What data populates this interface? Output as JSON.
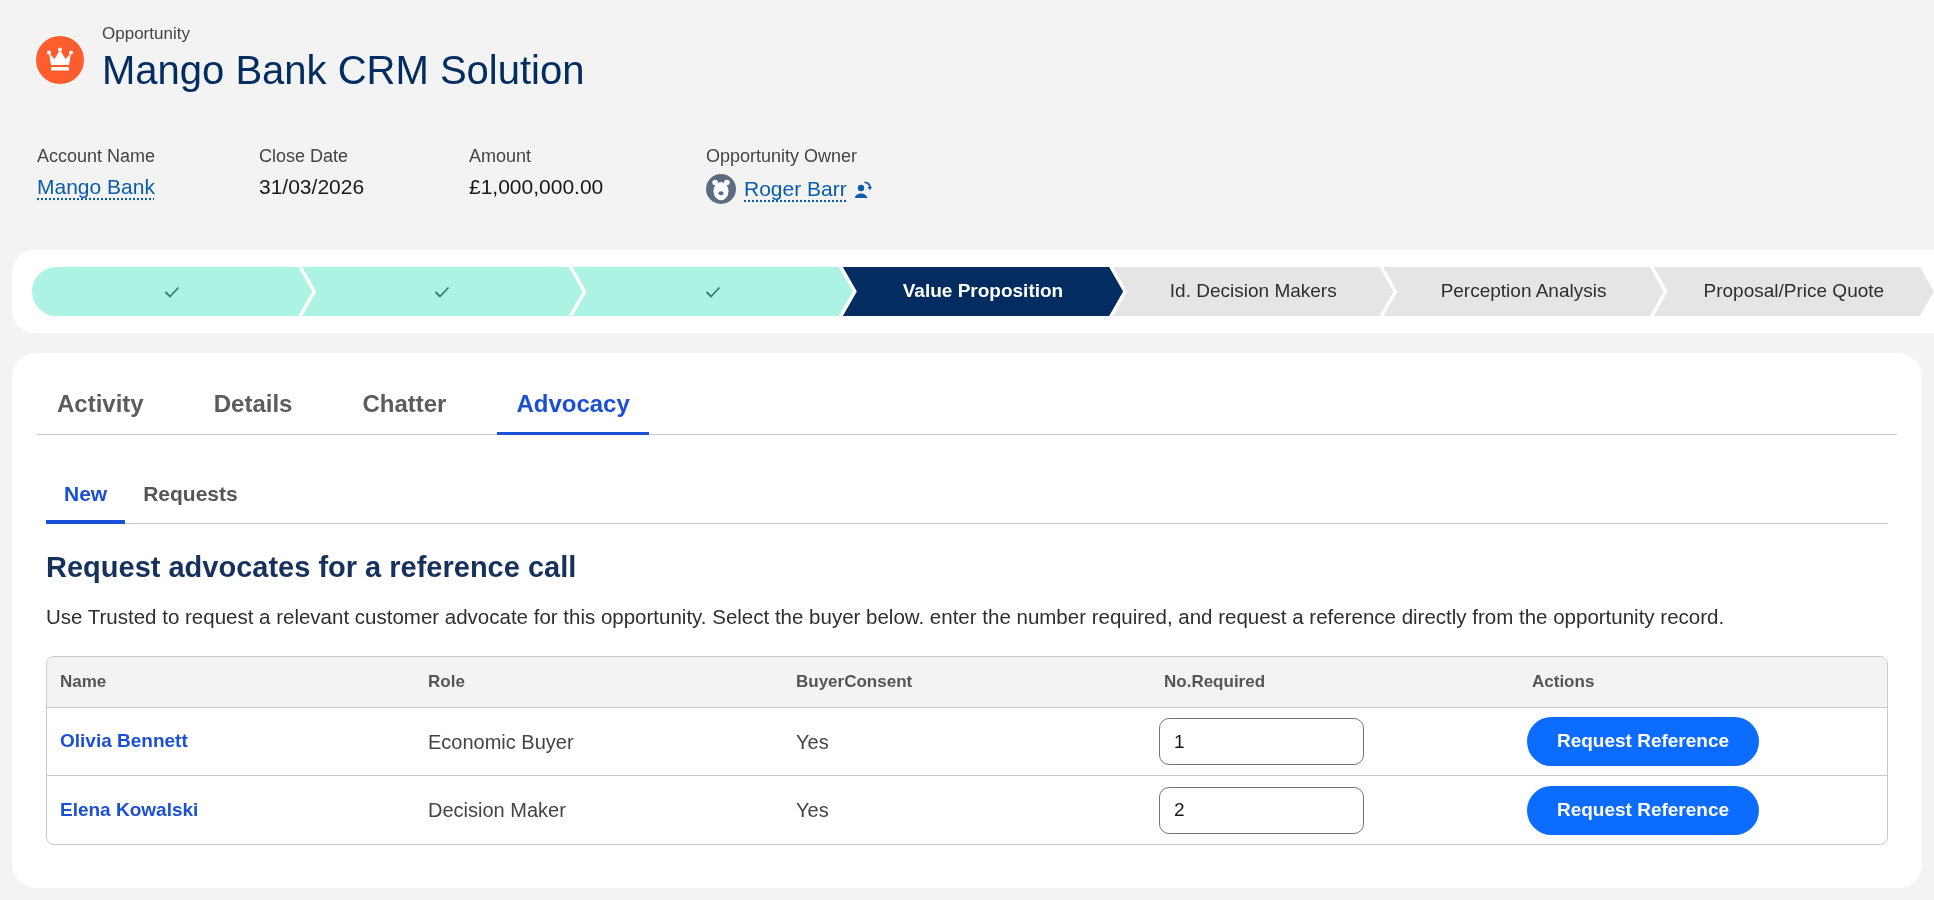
{
  "header": {
    "object_type": "Opportunity",
    "title": "Mango Bank CRM Solution"
  },
  "fields": [
    {
      "label": "Account Name",
      "value": "Mango Bank",
      "kind": "link"
    },
    {
      "label": "Close Date",
      "value": "31/03/2026",
      "kind": "text"
    },
    {
      "label": "Amount",
      "value": "£1,000,000.00",
      "kind": "text"
    },
    {
      "label": "Opportunity Owner",
      "value": "Roger Barr",
      "kind": "owner"
    }
  ],
  "path": [
    {
      "complete": true,
      "selected": false
    },
    {
      "complete": true,
      "selected": false
    },
    {
      "complete": true,
      "selected": false
    },
    {
      "label": "Value Proposition",
      "complete": false,
      "selected": true
    },
    {
      "label": "Id. Decision Makers",
      "complete": false,
      "selected": false
    },
    {
      "label": "Perception Analysis",
      "complete": false,
      "selected": false
    },
    {
      "label": "Proposal/Price Quote",
      "complete": false,
      "selected": false
    }
  ],
  "tabs": [
    {
      "label": "Activity",
      "selected": false
    },
    {
      "label": "Details",
      "selected": false
    },
    {
      "label": "Chatter",
      "selected": false
    },
    {
      "label": "Advocacy",
      "selected": true
    }
  ],
  "subtabs": [
    {
      "label": "New",
      "selected": true
    },
    {
      "label": "Requests",
      "selected": false
    }
  ],
  "section": {
    "heading": "Request advocates for a reference call",
    "description": "Use Trusted to request a relevant customer advocate for this opportunity. Select the buyer below. enter the number required, and request a reference directly from the opportunity record."
  },
  "table": {
    "columns": [
      "Name",
      "Role",
      "BuyerConsent",
      "No.Required",
      "Actions"
    ],
    "rows": [
      {
        "name": "Olivia Bennett",
        "role": "Economic Buyer",
        "buyer_consent": "Yes",
        "required": "1",
        "action": "Request Reference"
      },
      {
        "name": "Elena Kowalski",
        "role": "Decision Maker",
        "buyer_consent": "Yes",
        "required": "2",
        "action": "Request Reference"
      }
    ]
  }
}
